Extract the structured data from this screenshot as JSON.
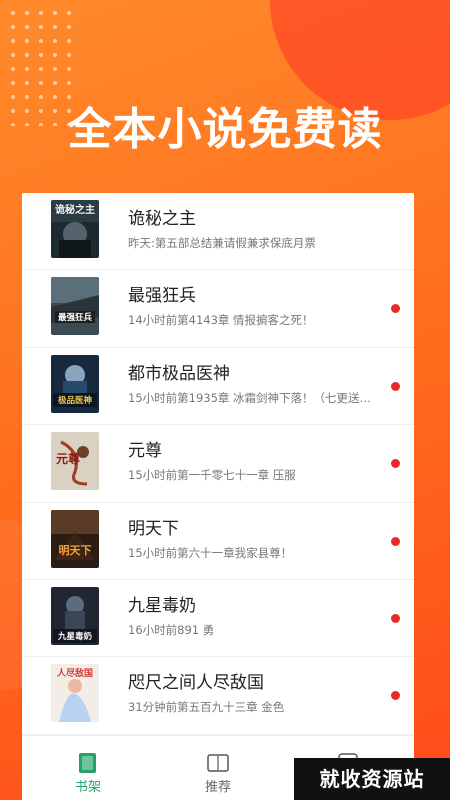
{
  "header": {
    "headline": "全本小说免费读"
  },
  "books": [
    {
      "title": "诡秘之主",
      "subtitle": "昨天:第五部总结兼请假兼求保底月票",
      "unread": false,
      "cover_art_text": "诡秘之主"
    },
    {
      "title": "最强狂兵",
      "subtitle": "14小时前第4143章 情报掮客之死！",
      "unread": true,
      "cover_art_text": "最强狂兵"
    },
    {
      "title": "都市极品医神",
      "subtitle": "15小时前第1935章 冰霜剑神下落！（七更送…",
      "unread": true,
      "cover_art_text": "极品医神"
    },
    {
      "title": "元尊",
      "subtitle": "15小时前第一千零七十一章 压服",
      "unread": true,
      "cover_art_text": "元尊"
    },
    {
      "title": "明天下",
      "subtitle": "15小时前第六十一章我家县尊！",
      "unread": true,
      "cover_art_text": "明天下"
    },
    {
      "title": "九星毒奶",
      "subtitle": "16小时前891 勇",
      "unread": true,
      "cover_art_text": "九星毒奶"
    },
    {
      "title": "咫尺之间人尽敌国",
      "subtitle": "31分钟前第五百九十三章 金色",
      "unread": true,
      "cover_art_text": "人尽敌国"
    }
  ],
  "tabs": [
    {
      "label": "书架",
      "icon": "bookshelf-icon",
      "active": true
    },
    {
      "label": "推荐",
      "icon": "open-book-icon",
      "active": false
    },
    {
      "label": "",
      "icon": "more-icon",
      "active": false
    }
  ],
  "watermark": {
    "text": "就收资源站"
  },
  "colors": {
    "accent_green": "#22a36a",
    "unread_dot": "#e8282a",
    "bg_orange": "#ff6a1c"
  }
}
